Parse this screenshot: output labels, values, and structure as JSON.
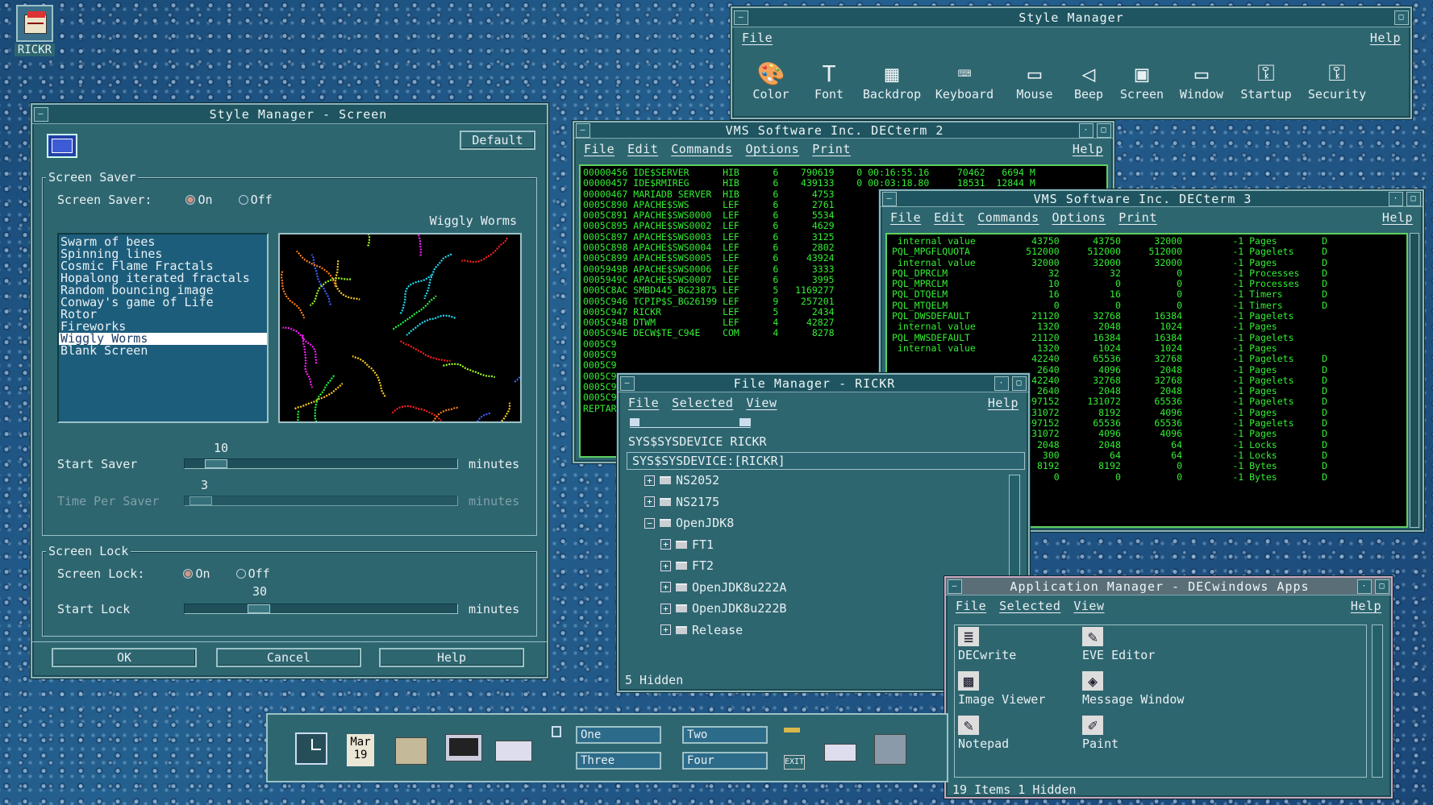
{
  "desktop": {
    "home_icon_label": "RICKR"
  },
  "style_manager": {
    "title": "Style Manager",
    "menu": [
      "File",
      "Help"
    ],
    "tools": [
      {
        "label": "Color",
        "icon": "palette-icon"
      },
      {
        "label": "Font",
        "icon": "font-icon"
      },
      {
        "label": "Backdrop",
        "icon": "backdrop-icon"
      },
      {
        "label": "Keyboard",
        "icon": "keyboard-icon"
      },
      {
        "label": "Mouse",
        "icon": "mouse-icon"
      },
      {
        "label": "Beep",
        "icon": "speaker-icon"
      },
      {
        "label": "Screen",
        "icon": "monitor-icon"
      },
      {
        "label": "Window",
        "icon": "window-icon"
      },
      {
        "label": "Startup",
        "icon": "key-icon"
      },
      {
        "label": "Security",
        "icon": "security-icon"
      }
    ]
  },
  "screen_dialog": {
    "title": "Style Manager - Screen",
    "default_btn": "Default",
    "saver_group": "Screen Saver",
    "saver_label": "Screen Saver:",
    "on": "On",
    "off": "Off",
    "saver_on": true,
    "preview_title": "Wiggly Worms",
    "savers": [
      "Swarm of bees",
      "Spinning lines",
      "Cosmic Flame Fractals",
      "Hopalong iterated fractals",
      "Random bouncing image",
      "Conway's game of Life",
      "Rotor",
      "Fireworks",
      "Wiggly Worms",
      "Blank Screen"
    ],
    "selected_saver": "Wiggly Worms",
    "start_saver_label": "Start Saver",
    "start_saver_value": "10",
    "start_saver_fraction": 0.08,
    "time_per_saver_label": "Time Per Saver",
    "time_per_saver_value": "3",
    "time_per_saver_fraction": 0.02,
    "minutes": "minutes",
    "lock_group": "Screen Lock",
    "lock_label": "Screen Lock:",
    "lock_on": true,
    "start_lock_label": "Start Lock",
    "start_lock_value": "30",
    "start_lock_fraction": 0.25,
    "ok": "OK",
    "cancel": "Cancel",
    "help": "Help"
  },
  "decterm2": {
    "title": "VMS Software Inc. DECterm 2",
    "menu": [
      "File",
      "Edit",
      "Commands",
      "Options",
      "Print",
      "Help"
    ],
    "lines": [
      "00000456 IDE$SERVER      HIB      6    790619    0 00:16:55.16     70462   6694 M",
      "00000457 IDE$RMIREG      HIB      6    439133    0 00:03:18.80     18531  12844 M",
      "00000467 MARIADB SERVER  HIB      6      4753",
      "0005C890 APACHE$SWS      LEF      6      2761",
      "0005C891 APACHE$SWS0000  LEF      6      5534",
      "0005C895 APACHE$SWS0002  LEF      6      4629",
      "0005C897 APACHE$SWS0003  LEF      6      3125",
      "0005C898 APACHE$SWS0004  LEF      6      2802",
      "0005C899 APACHE$SWS0005  LEF      6     43924",
      "0005949B APACHE$SWS0006  LEF      6      3333",
      "0005949C APACHE$SWS0007  LEF      6      3995",
      "0005C8AC SMBD445_BG23875 LEF      5   1169277",
      "0005C946 TCPIP$S_BG26199 LEF      9    257201",
      "0005C947 RICKR           LEF      5      2434",
      "0005C94B DTWM            LEF      4     42827",
      "0005C94E DECW$TE_C94E    COM      4      8278",
      "0005C9",
      "0005C9",
      "0005C9",
      "0005C9",
      "0005C9",
      "0005C9",
      "REPTAR"
    ]
  },
  "decterm3": {
    "title": "VMS Software Inc. DECterm 3",
    "menu": [
      "File",
      "Edit",
      "Commands",
      "Options",
      "Print",
      "Help"
    ],
    "lines": [
      " internal value          43750      43750      32000         -1 Pages        D",
      "PQL_MPGFLQUOTA          512000     512000     512000         -1 Pagelets     D",
      " internal value          32000      32000      32000         -1 Pages        D",
      "PQL_DPRCLM                  32         32          0         -1 Processes    D",
      "PQL_MPRCLM                  10          0          0         -1 Processes    D",
      "PQL_DTQELM                  16         16          0         -1 Timers       D",
      "PQL_MTQELM                   0          0          0         -1 Timers       D",
      "PQL_DWSDEFAULT           21120      32768      16384         -1 Pagelets",
      " internal value           1320       2048       1024         -1 Pages",
      "PQL_MWSDEFAULT           21120      16384      16384         -1 Pagelets",
      " internal value           1320       1024       1024         -1 Pages",
      "                         42240      65536      32768         -1 Pagelets     D",
      "                          2640       4096       2048         -1 Pages        D",
      "                         42240      32768      32768         -1 Pagelets     D",
      "                          2640       2048       2048         -1 Pages        D",
      "                       2097152     131072      65536         -1 Pagelets     D",
      "                        131072       8192       4096         -1 Pages        D",
      "                       2097152      65536      65536         -1 Pagelets     D",
      "                        131072       4096       4096         -1 Pages        D",
      "                          2048       2048         64         -1 Locks        D",
      "                           300         64         64         -1 Locks        D",
      "                          8192       8192          0         -1 Bytes        D",
      "                             0          0          0         -1 Bytes        D"
    ]
  },
  "file_manager": {
    "title": "File Manager - RICKR",
    "menu": [
      "File",
      "Selected",
      "View",
      "Help"
    ],
    "path_label": "SYS$SYSDEVICE RICKR",
    "path_field": "SYS$SYSDEVICE:[RICKR]",
    "tree": [
      {
        "name": "NS2052",
        "sign": "+",
        "level": 0
      },
      {
        "name": "NS2175",
        "sign": "+",
        "level": 0
      },
      {
        "name": "OpenJDK8",
        "sign": "−",
        "level": 0
      },
      {
        "name": "FT1",
        "sign": "+",
        "level": 1
      },
      {
        "name": "FT2",
        "sign": "+",
        "level": 1
      },
      {
        "name": "OpenJDK8u222A",
        "sign": "+",
        "level": 1
      },
      {
        "name": "OpenJDK8u222B",
        "sign": "+",
        "level": 1
      },
      {
        "name": "Release",
        "sign": "+",
        "level": 1
      }
    ],
    "status": "5 Hidden"
  },
  "app_manager": {
    "title": "Application Manager - DECwindows Apps",
    "menu": [
      "File",
      "Selected",
      "View",
      "Help"
    ],
    "items": [
      {
        "label": "DECwrite",
        "icon": "document-icon"
      },
      {
        "label": "EVE Editor",
        "icon": "editor-icon"
      },
      {
        "label": "Image Viewer",
        "icon": "image-icon"
      },
      {
        "label": "Message Window",
        "icon": "message-icon"
      },
      {
        "label": "Notepad",
        "icon": "notepad-icon"
      },
      {
        "label": "Paint",
        "icon": "paint-icon"
      }
    ],
    "status": "19 Items 1 Hidden"
  },
  "front_panel": {
    "date_month": "Mar",
    "date_day": "19",
    "workspaces": [
      "One",
      "Two",
      "Three",
      "Four"
    ],
    "exit_label": "EXIT"
  },
  "colors": {
    "window_bg": "#2e6670",
    "terminal_fg": "#33ee33",
    "app_mgr_frame": "#c9a6c0"
  }
}
